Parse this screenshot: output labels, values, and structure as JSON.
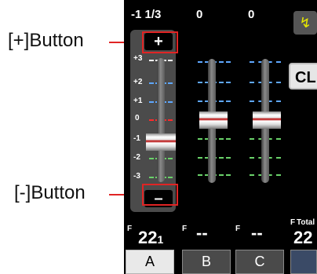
{
  "callouts": {
    "plus_label": "[+]Button",
    "minus_label": "[-]Button"
  },
  "header": {
    "col1": "-1 1/3",
    "col2": "0",
    "col3": "0"
  },
  "controls": {
    "plus_symbol": "+",
    "minus_symbol": "–",
    "clear_label": "CL",
    "flash_icon": "flash-icon"
  },
  "scale_labels": [
    "+3",
    "+2",
    "+1",
    "0",
    "-1",
    "-2",
    "-3"
  ],
  "footer": {
    "f_letter": "F",
    "a_value": "22",
    "a_sub": "1",
    "b_value": "--",
    "c_value": "--",
    "total_label": "Total",
    "total_value": "22"
  },
  "tabs": [
    "A",
    "B",
    "C"
  ],
  "colors": {
    "accent_red": "#e02424",
    "tick_blue": "#5fa8ff",
    "tick_green": "#6ad26a"
  }
}
